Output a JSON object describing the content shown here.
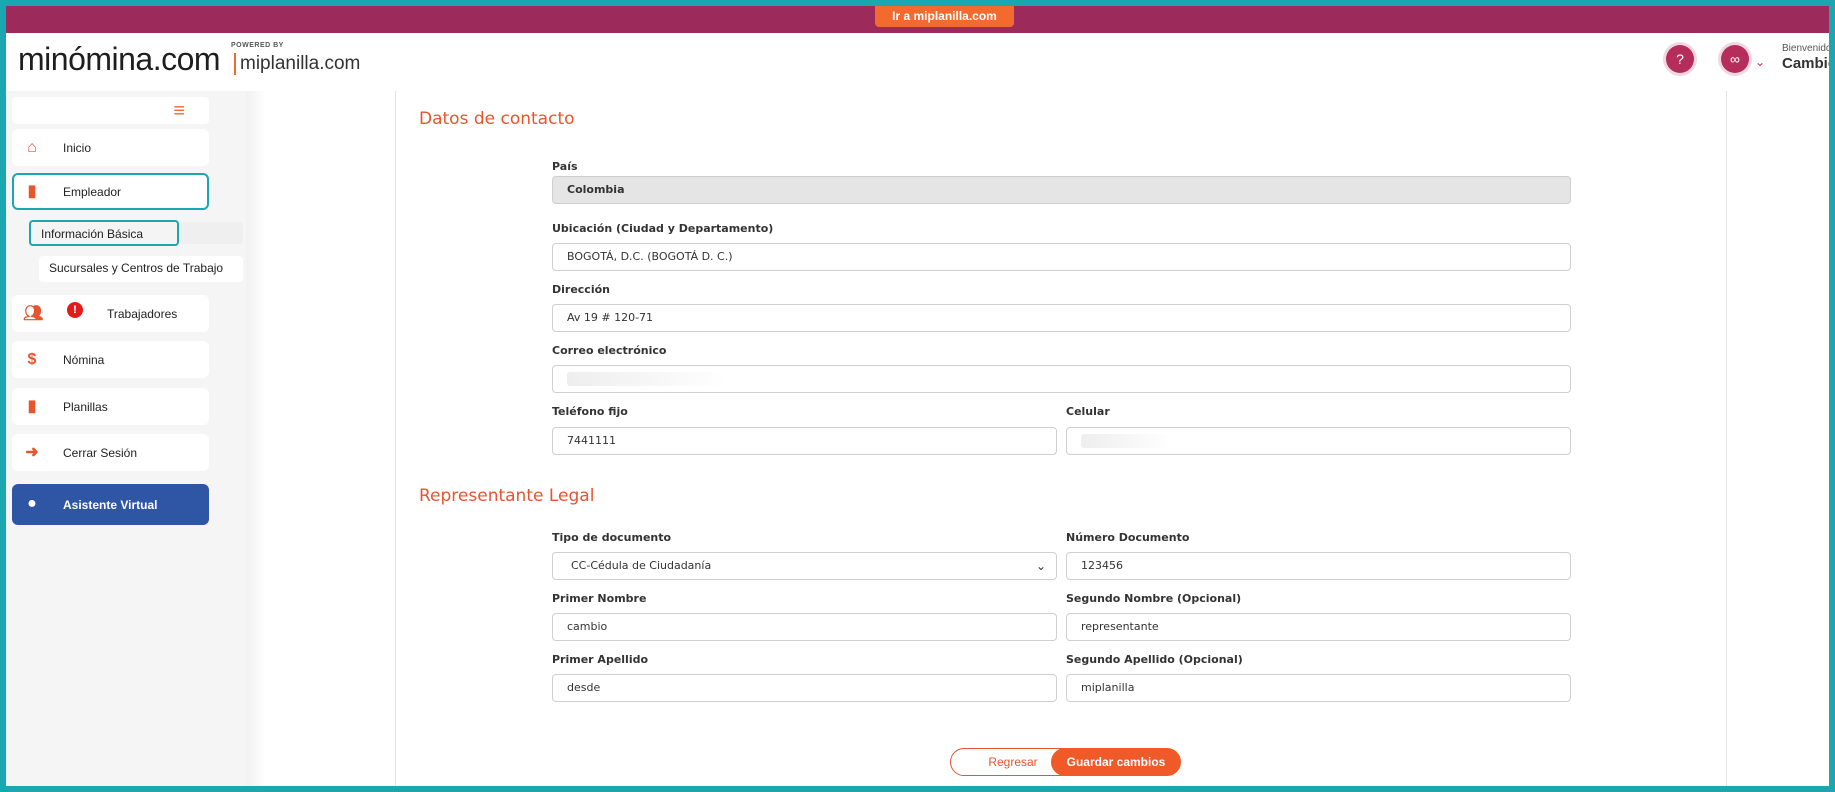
{
  "topbar": {
    "link_label": "Ir a miplanilla.com"
  },
  "header": {
    "logo_main": "minómina.com",
    "logo_powered": "POWERED BY",
    "logo_sub": "miplanilla.com",
    "welcome_label": "Bienvenido",
    "user_name": "Cambio"
  },
  "sidebar": {
    "items": [
      {
        "label": "Inicio",
        "icon": "home-icon"
      },
      {
        "label": "Empleador",
        "icon": "building-icon"
      },
      {
        "label": "Trabajadores",
        "icon": "users-icon"
      },
      {
        "label": "Nómina",
        "icon": "dollar-icon"
      },
      {
        "label": "Planillas",
        "icon": "clipboard-icon"
      },
      {
        "label": "Cerrar Sesión",
        "icon": "logout-icon"
      },
      {
        "label": "Asistente Virtual",
        "icon": "chat-icon"
      }
    ],
    "sub_items": [
      {
        "label": "Información Básica"
      },
      {
        "label": "Sucursales y Centros de Trabajo"
      }
    ],
    "alert_glyph": "!"
  },
  "contacto": {
    "title": "Datos de contacto",
    "pais_label": "País",
    "pais_value": "Colombia",
    "ubicacion_label": "Ubicación (Ciudad y Departamento)",
    "ubicacion_value": "BOGOTÁ, D.C. (BOGOTÁ  D. C.)",
    "direccion_label": "Dirección",
    "direccion_value": "Av 19 # 120-71",
    "correo_label": "Correo electrónico",
    "telefono_label": "Teléfono fijo",
    "telefono_value": "7441111",
    "celular_label": "Celular"
  },
  "representante": {
    "title": "Representante Legal",
    "tipo_doc_label": "Tipo de documento",
    "tipo_doc_value": "CC-Cédula de Ciudadanía",
    "num_doc_label": "Número Documento",
    "num_doc_value": "123456",
    "primer_nombre_label": "Primer Nombre",
    "primer_nombre_value": "cambio",
    "segundo_nombre_label": "Segundo Nombre (Opcional)",
    "segundo_nombre_value": "representante",
    "primer_apellido_label": "Primer Apellido",
    "primer_apellido_value": "desde",
    "segundo_apellido_label": "Segundo Apellido (Opcional)",
    "segundo_apellido_value": "miplanilla"
  },
  "actions": {
    "back_label": "Regresar",
    "save_label": "Guardar cambios"
  },
  "colors": {
    "brand_magenta": "#9c2a5a",
    "accent_orange": "#f26a2e",
    "frame_teal": "#1aa7b0",
    "assistant_blue": "#2f55a5"
  }
}
